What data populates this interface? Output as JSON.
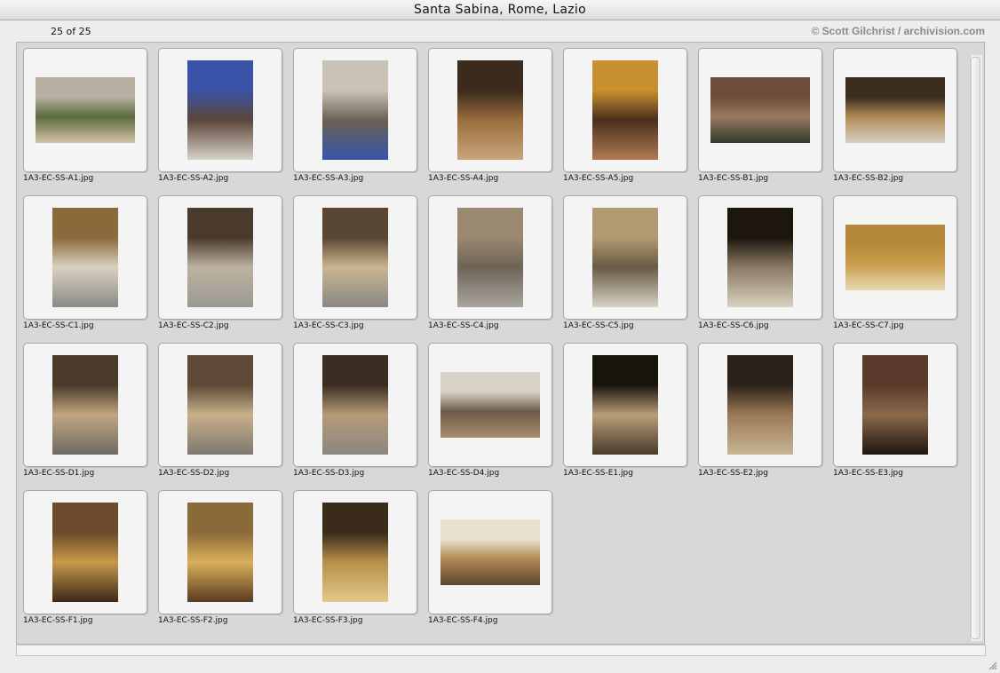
{
  "window": {
    "title": "Santa Sabina, Rome, Lazio"
  },
  "toolbar": {
    "count": "25 of 25",
    "credit": "© Scott Gilchrist / archivision.com"
  },
  "gallery": {
    "items": [
      {
        "filename": "1A3-EC-SS-A1.jpg",
        "orientation": "l",
        "colors": [
          "#b7b0a2",
          "#5a6b3c",
          "#d6c2a8"
        ]
      },
      {
        "filename": "1A3-EC-SS-A2.jpg",
        "orientation": "p",
        "colors": [
          "#3a52a8",
          "#5a4638",
          "#d8d2c8"
        ]
      },
      {
        "filename": "1A3-EC-SS-A3.jpg",
        "orientation": "p",
        "colors": [
          "#c9c3b6",
          "#6b6256",
          "#3854a8"
        ]
      },
      {
        "filename": "1A3-EC-SS-A4.jpg",
        "orientation": "p",
        "colors": [
          "#3b2a1c",
          "#9a6c3e",
          "#c9a57c"
        ]
      },
      {
        "filename": "1A3-EC-SS-A5.jpg",
        "orientation": "p",
        "colors": [
          "#c8902e",
          "#4a2f1e",
          "#b07a54"
        ]
      },
      {
        "filename": "1A3-EC-SS-B1.jpg",
        "orientation": "l",
        "colors": [
          "#6d4e3a",
          "#9a7a62",
          "#2e3a2c"
        ]
      },
      {
        "filename": "1A3-EC-SS-B2.jpg",
        "orientation": "l",
        "colors": [
          "#3a2c1e",
          "#b08a55",
          "#d8cfc2"
        ]
      },
      {
        "filename": "1A3-EC-SS-C1.jpg",
        "orientation": "p",
        "colors": [
          "#8a6a3a",
          "#d8d0c0",
          "#8c8a86"
        ]
      },
      {
        "filename": "1A3-EC-SS-C2.jpg",
        "orientation": "p",
        "colors": [
          "#4a3a2c",
          "#bdb2a0",
          "#9a9894"
        ]
      },
      {
        "filename": "1A3-EC-SS-C3.jpg",
        "orientation": "p",
        "colors": [
          "#5a4634",
          "#c9b690",
          "#8a8884"
        ]
      },
      {
        "filename": "1A3-EC-SS-C4.jpg",
        "orientation": "p",
        "colors": [
          "#9a8870",
          "#6e6256",
          "#a8a6a0"
        ]
      },
      {
        "filename": "1A3-EC-SS-C5.jpg",
        "orientation": "p",
        "colors": [
          "#b09a72",
          "#6a5a44",
          "#d6d2c8"
        ]
      },
      {
        "filename": "1A3-EC-SS-C6.jpg",
        "orientation": "p",
        "colors": [
          "#1c160e",
          "#8a7a62",
          "#d8d2c0"
        ]
      },
      {
        "filename": "1A3-EC-SS-C7.jpg",
        "orientation": "l",
        "colors": [
          "#b48a3a",
          "#c99e4c",
          "#e8d8b0"
        ]
      },
      {
        "filename": "1A3-EC-SS-D1.jpg",
        "orientation": "p",
        "colors": [
          "#4a3a2a",
          "#c0a682",
          "#6e6a62"
        ]
      },
      {
        "filename": "1A3-EC-SS-D2.jpg",
        "orientation": "p",
        "colors": [
          "#5e4a36",
          "#c8b08a",
          "#7c7870"
        ]
      },
      {
        "filename": "1A3-EC-SS-D3.jpg",
        "orientation": "p",
        "colors": [
          "#3a2e22",
          "#b59c78",
          "#8a8680"
        ]
      },
      {
        "filename": "1A3-EC-SS-D4.jpg",
        "orientation": "l",
        "colors": [
          "#d8d2c6",
          "#6a5a4a",
          "#a88e6a"
        ]
      },
      {
        "filename": "1A3-EC-SS-E1.jpg",
        "orientation": "p",
        "colors": [
          "#1a140e",
          "#b89e78",
          "#4a3a2a"
        ]
      },
      {
        "filename": "1A3-EC-SS-E2.jpg",
        "orientation": "p",
        "colors": [
          "#2a221a",
          "#9a7a56",
          "#c8b494"
        ]
      },
      {
        "filename": "1A3-EC-SS-E3.jpg",
        "orientation": "p",
        "colors": [
          "#5a3a2a",
          "#8a6a4a",
          "#1e1610"
        ]
      },
      {
        "filename": "1A3-EC-SS-F1.jpg",
        "orientation": "p",
        "colors": [
          "#6a4a2a",
          "#c89a4a",
          "#3a281a"
        ]
      },
      {
        "filename": "1A3-EC-SS-F2.jpg",
        "orientation": "p",
        "colors": [
          "#8a6a3a",
          "#d8b05a",
          "#5a3a22"
        ]
      },
      {
        "filename": "1A3-EC-SS-F3.jpg",
        "orientation": "p",
        "colors": [
          "#3a2a1a",
          "#b8904a",
          "#e0c88a"
        ]
      },
      {
        "filename": "1A3-EC-SS-F4.jpg",
        "orientation": "l",
        "colors": [
          "#e8e0d0",
          "#b08a52",
          "#5a4632"
        ]
      }
    ]
  }
}
